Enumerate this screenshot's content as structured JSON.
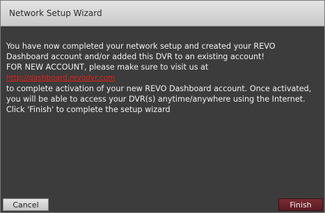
{
  "window": {
    "title": "Network Setup Wizard"
  },
  "message": {
    "paragraph1": "You have now completed your network setup and created your REVO Dashboard account and/or added this DVR to an existing account!",
    "paragraph2_intro": "FOR NEW ACCOUNT, please make sure to visit us at",
    "link_text": "http://dashboard.revodvr.com",
    "paragraph2_rest": "to complete activation of your new REVO Dashboard account. Once activated, you will be able to access your DVR(s) anytime/anywhere using the Internet.",
    "paragraph3": "Click 'Finish' to complete the setup wizard"
  },
  "buttons": {
    "cancel_label": "Cancel",
    "finish_label": "Finish"
  },
  "colors": {
    "link": "#e1201a",
    "finish_button": "#6a222b",
    "background": "#3c3c3c"
  }
}
